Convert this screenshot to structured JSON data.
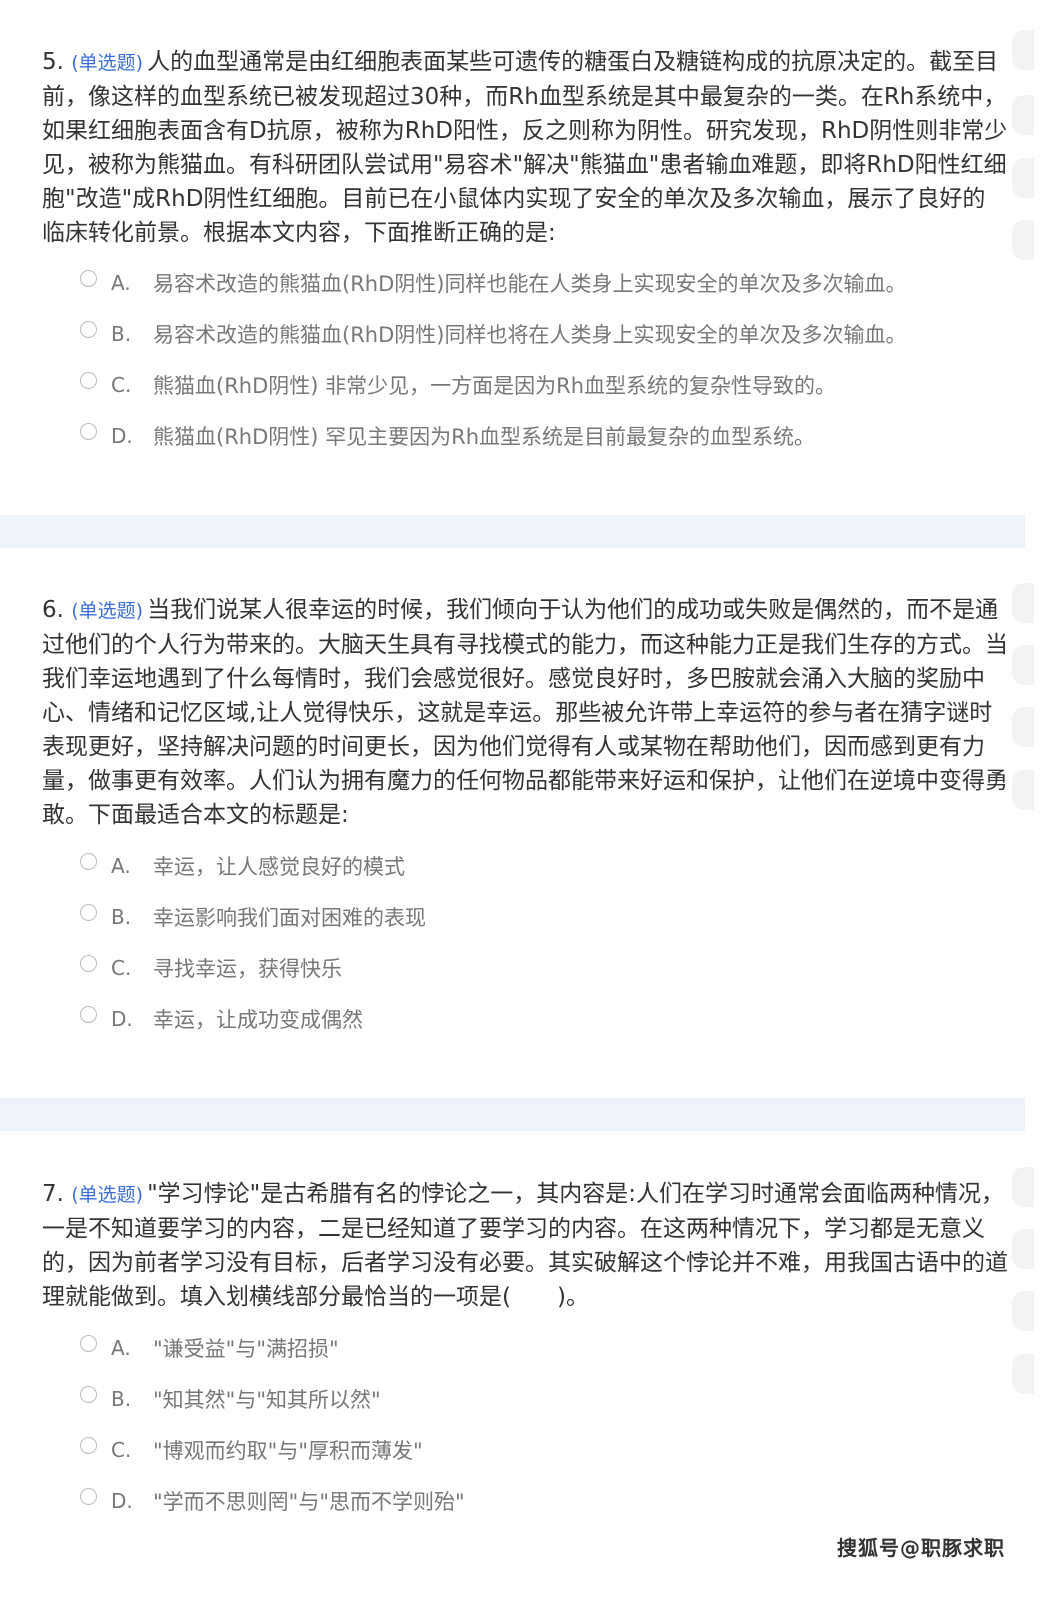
{
  "questions": [
    {
      "number": "5.",
      "type": "(单选题)",
      "stem": "人的血型通常是由红细胞表面某些可遗传的糖蛋白及糖链构成的抗原决定的。截至目前，像这样的血型系统已被发现超过30种，而Rh血型系统是其中最复杂的一类。在Rh系统中，如果红细胞表面含有D抗原，被称为RhD阳性，反之则称为阴性。研究发现，RhD阴性则非常少见，被称为熊猫血。有科研团队尝试用\"易容术\"解决\"熊猫血\"患者输血难题，即将RhD阳性红细胞\"改造\"成RhD阴性红细胞。目前已在小鼠体内实现了安全的单次及多次输血，展示了良好的临床转化前景。根据本文内容，下面推断正确的是:",
      "options": [
        {
          "letter": "A.",
          "text": "易容术改造的熊猫血(RhD阴性)同样也能在人类身上实现安全的单次及多次输血。"
        },
        {
          "letter": "B.",
          "text": "易容术改造的熊猫血(RhD阴性)同样也将在人类身上实现安全的单次及多次输血。"
        },
        {
          "letter": "C.",
          "text": "熊猫血(RhD阴性) 非常少见，一方面是因为Rh血型系统的复杂性导致的。"
        },
        {
          "letter": "D.",
          "text": "熊猫血(RhD阴性) 罕见主要因为Rh血型系统是目前最复杂的血型系统。"
        }
      ]
    },
    {
      "number": "6.",
      "type": "(单选题)",
      "stem": "当我们说某人很幸运的时候，我们倾向于认为他们的成功或失败是偶然的，而不是通过他们的个人行为带来的。大脑天生具有寻找模式的能力，而这种能力正是我们生存的方式。当我们幸运地遇到了什么每情时，我们会感觉很好。感觉良好时，多巴胺就会涌入大脑的奖励中心、情绪和记忆区域,让人觉得快乐，这就是幸运。那些被允许带上幸运符的参与者在猜字谜时表现更好，坚持解决问题的时间更长，因为他们觉得有人或某物在帮助他们，因而感到更有力量，做事更有效率。人们认为拥有魔力的任何物品都能带来好运和保护，让他们在逆境中变得勇敢。下面最适合本文的标题是:",
      "options": [
        {
          "letter": "A.",
          "text": "幸运，让人感觉良好的模式"
        },
        {
          "letter": "B.",
          "text": "幸运影响我们面对困难的表现"
        },
        {
          "letter": "C.",
          "text": "寻找幸运，获得快乐"
        },
        {
          "letter": "D.",
          "text": "幸运，让成功变成偶然"
        }
      ]
    },
    {
      "number": "7.",
      "type": "(单选题)",
      "stem": "\"学习悖论\"是古希腊有名的悖论之一，其内容是:人们在学习时通常会面临两种情况，一是不知道要学习的内容，二是已经知道了要学习的内容。在这两种情况下，学习都是无意义的，因为前者学习没有目标，后者学习没有必要。其实破解这个悖论并不难，用我国古语中的道理就能做到。填入划横线部分最恰当的一项是(　　)。",
      "options": [
        {
          "letter": "A.",
          "text": "\"谦受益\"与\"满招损\""
        },
        {
          "letter": "B.",
          "text": "\"知其然\"与\"知其所以然\""
        },
        {
          "letter": "C.",
          "text": "\"博观而约取\"与\"厚积而薄发\""
        },
        {
          "letter": "D.",
          "text": "\"学而不思则罔\"与\"思而不学则殆\""
        }
      ]
    }
  ],
  "watermark": "搜狐号@职豚求职",
  "colors": {
    "type_label": "#3a6fd8",
    "separator": "#eef2fb",
    "option_text": "#777777"
  }
}
